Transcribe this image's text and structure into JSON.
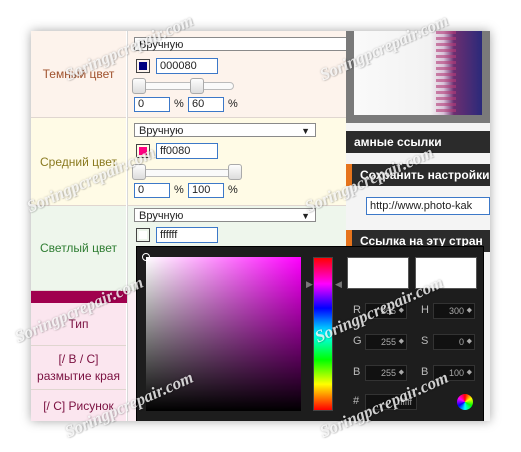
{
  "dark_color": {
    "label": "Темный цвет",
    "mode": "Вручную",
    "hex": "000080",
    "swatch": "#000080",
    "value1": "0",
    "value2": "60",
    "pct1": "%",
    "pct2": "%",
    "slider_level_fraction": 0.6
  },
  "mid_color": {
    "label": "Средний цвет",
    "mode": "Вручную",
    "hex": "ff0080",
    "swatch": "#ff0080",
    "value1": "0",
    "value2": "100",
    "pct1": "%",
    "pct2": "%",
    "slider_level_fraction": 1.0
  },
  "light_color": {
    "label": "Светлый цвет",
    "mode": "Вручную",
    "hex": "ffffff",
    "swatch": "#ffffff"
  },
  "rows": {
    "type_label": "Тип",
    "edge_blur_label": "[/ B / C] размытие края",
    "picture_label": "[/ C] Рисунок"
  },
  "right_panel": {
    "links_title": "амные ссылки",
    "save_settings_title": "Сохранить настройки",
    "url_value": "http://www.photo-kak",
    "link_to_page_title": "Ссылка на эту стран"
  },
  "picker": {
    "r_label": "R",
    "r_value": "255",
    "g_label": "G",
    "g_value": "255",
    "b_label": "B",
    "b_value": "255",
    "h_label": "H",
    "h_value": "300",
    "s_label": "S",
    "s_value": "0",
    "v_label": "B",
    "v_value": "100",
    "hex_label": "#",
    "hex_value": "ffffff"
  },
  "watermark": "Soringpcrepair.com",
  "colors": {
    "dark_row_bg": "#fdf3ec",
    "mid_row_bg": "#fffbe6",
    "light_row_bg": "#eef6ec",
    "accent_bar": "#a0004e",
    "type_row_bg": "#fbe6ef",
    "orange_accent": "#e6741c"
  }
}
